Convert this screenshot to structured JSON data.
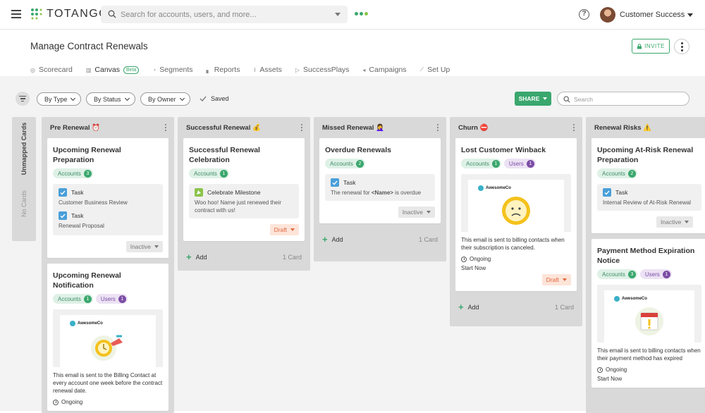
{
  "app": {
    "brand": "TOTANGO",
    "search_placeholder": "Search for accounts, users, and more...",
    "user_name": "Customer Success"
  },
  "page": {
    "title": "Manage Contract Renewals",
    "invite_label": "INVITE",
    "tabs": [
      {
        "label": "Scorecard",
        "icon": "scorecard-icon"
      },
      {
        "label": "Canvas",
        "icon": "canvas-icon",
        "badge": "Beta",
        "active": true
      },
      {
        "label": "Segments",
        "icon": "segments-icon"
      },
      {
        "label": "Reports",
        "icon": "reports-icon"
      },
      {
        "label": "Assets",
        "icon": "assets-icon"
      },
      {
        "label": "SuccessPlays",
        "icon": "play-icon"
      },
      {
        "label": "Campaigns",
        "icon": "megaphone-icon"
      },
      {
        "label": "Set Up",
        "icon": "wand-icon"
      }
    ]
  },
  "toolbar": {
    "by_type": "By Type",
    "by_status": "By Status",
    "by_owner": "By Owner",
    "saved": "Saved",
    "share": "SHARE",
    "search_placeholder": "Search"
  },
  "unmapped": {
    "title": "Unmapped Cards",
    "empty": "No Cards"
  },
  "columns": [
    {
      "title": "Pre Renewal ⏰",
      "cards": [
        {
          "title": "Upcoming Renewal Preparation",
          "accounts_label": "Accounts",
          "accounts_count": "3",
          "tasks": [
            {
              "label": "Task",
              "sub": "Customer Business Review"
            },
            {
              "label": "Task",
              "sub": "Renewal Proposal"
            }
          ],
          "status": "Inactive"
        },
        {
          "title": "Upcoming Renewal Notification",
          "accounts_label": "Accounts",
          "accounts_count": "1",
          "users_label": "Users",
          "users_count": "1",
          "email_brand": "AwesomeCo",
          "email_text": "This email is sent to the Billing Contact at every account one week before the contract renewal date.",
          "email_status": "Ongoing"
        }
      ]
    },
    {
      "title": "Successful Renewal 💰",
      "cards": [
        {
          "title": "Successful Renewal Celebration",
          "accounts_label": "Accounts",
          "accounts_count": "1",
          "milestone_label": "Celebrate Milestone",
          "milestone_text": "Woo hoo!  Name just renewed their contract with us!",
          "status": "Draft"
        }
      ],
      "add_label": "Add",
      "count": "1 Card"
    },
    {
      "title": "Missed Renewal 🤦‍♀️",
      "cards": [
        {
          "title": "Overdue Renewals",
          "accounts_label": "Accounts",
          "accounts_count": "2",
          "task_label": "Task",
          "task_text_pre": "The renewal for ",
          "task_text_bold": "<Name>",
          "task_text_post": " is overdue",
          "status": "Inactive"
        }
      ],
      "add_label": "Add",
      "count": "1 Card"
    },
    {
      "title": "Churn ⛔",
      "cards": [
        {
          "title": "Lost Customer Winback",
          "accounts_label": "Accounts",
          "accounts_count": "1",
          "users_label": "Users",
          "users_count": "1",
          "email_brand": "AwesomeCo",
          "email_text": "This email is sent to billing contacts when their subscription is canceled.",
          "email_status": "Ongoing",
          "email_start": "Start Now",
          "status": "Draft"
        }
      ],
      "add_label": "Add",
      "count": "1 Card"
    },
    {
      "title": "Renewal Risks ⚠️",
      "cards": [
        {
          "title": "Upcoming At-Risk Renewal Preparation",
          "accounts_label": "Accounts",
          "accounts_count": "2",
          "task_label": "Task",
          "task_sub": "Internal Review of At-Risk Renewal",
          "status": "Inactive"
        },
        {
          "title": "Payment Method Expiration Notice",
          "accounts_label": "Accounts",
          "accounts_count": "3",
          "users_label": "Users",
          "users_count": "1",
          "email_brand": "AwesomeCo",
          "email_text": "This email is sent to billing contacts when their payment method has expired",
          "email_status": "Ongoing",
          "email_start": "Start Now"
        }
      ]
    }
  ],
  "colors": {
    "accent": "#3aa76d",
    "users": "#7b4da5",
    "draft": "#e2683c"
  }
}
